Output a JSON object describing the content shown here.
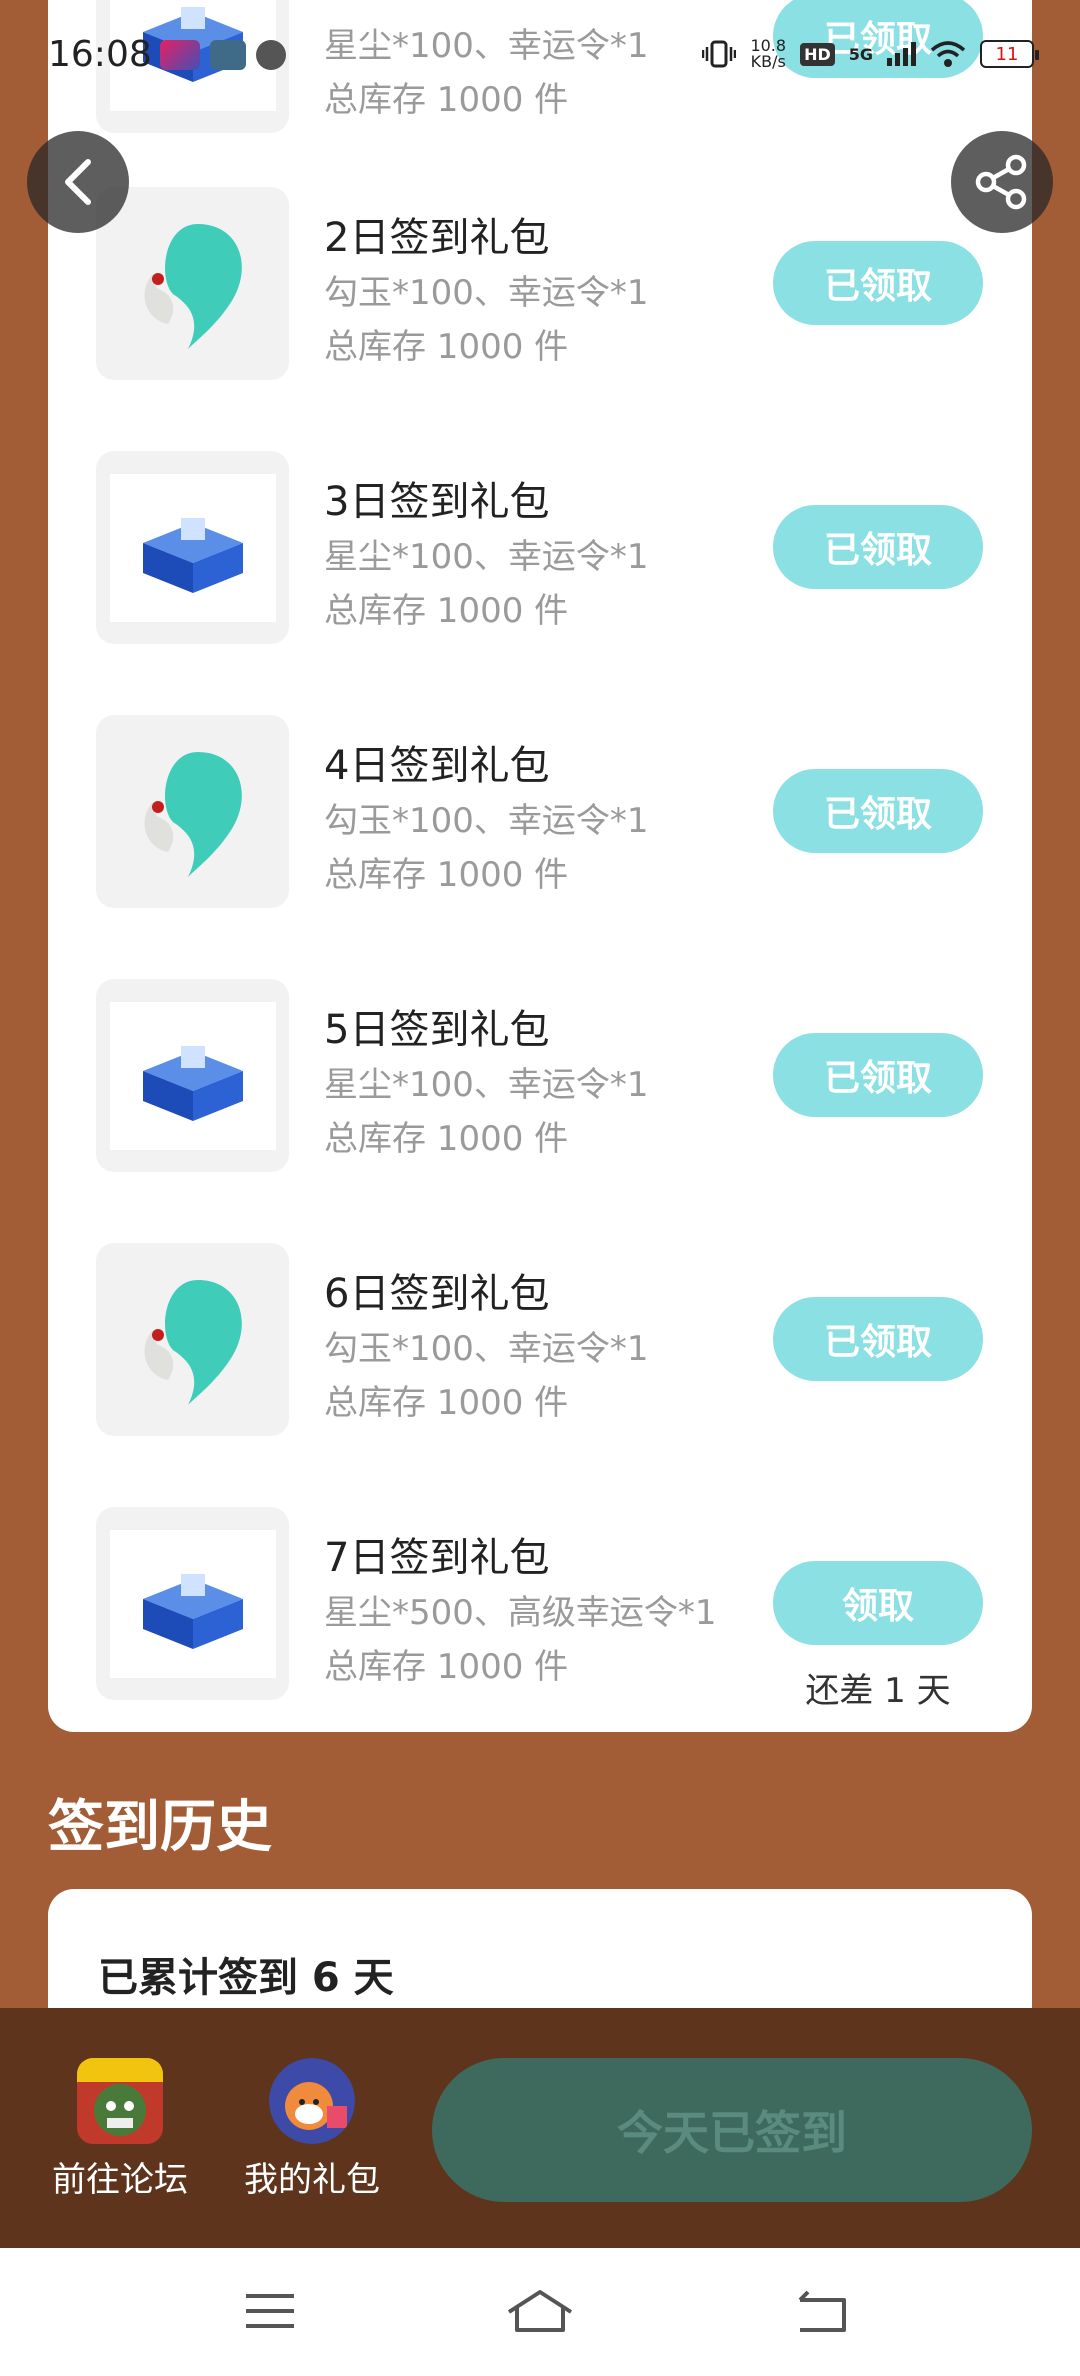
{
  "status_bar": {
    "time": "16:08",
    "net_speed": "10.8",
    "net_unit": "KB/s",
    "hd": "HD",
    "network": "5G",
    "battery": "11"
  },
  "gifts": [
    {
      "title": "",
      "desc": "星尘*100、幸运令*1",
      "stock": "总库存 1000 件",
      "icon": "blue-chest-icon",
      "button": "已领取",
      "remain": ""
    },
    {
      "title": "2日签到礼包",
      "desc": "勾玉*100、幸运令*1",
      "stock": "总库存 1000 件",
      "icon": "jade-magatama-icon",
      "button": "已领取",
      "remain": ""
    },
    {
      "title": "3日签到礼包",
      "desc": "星尘*100、幸运令*1",
      "stock": "总库存 1000 件",
      "icon": "blue-chest-icon",
      "button": "已领取",
      "remain": ""
    },
    {
      "title": "4日签到礼包",
      "desc": "勾玉*100、幸运令*1",
      "stock": "总库存 1000 件",
      "icon": "jade-magatama-icon",
      "button": "已领取",
      "remain": ""
    },
    {
      "title": "5日签到礼包",
      "desc": "星尘*100、幸运令*1",
      "stock": "总库存 1000 件",
      "icon": "blue-chest-icon",
      "button": "已领取",
      "remain": ""
    },
    {
      "title": "6日签到礼包",
      "desc": "勾玉*100、幸运令*1",
      "stock": "总库存 1000 件",
      "icon": "jade-magatama-icon",
      "button": "已领取",
      "remain": ""
    },
    {
      "title": "7日签到礼包",
      "desc": "星尘*500、高级幸运令*1",
      "stock": "总库存 1000 件",
      "icon": "blue-chest-icon",
      "button": "领取",
      "remain": "还差 1 天"
    }
  ],
  "history": {
    "heading": "签到历史",
    "count": "已累计签到 6 天"
  },
  "bottom_bar": {
    "forum_label": "前往论坛",
    "gifts_label": "我的礼包",
    "signin_label": "今天已签到"
  },
  "colors": {
    "page_bg": "#a35d36",
    "bottom_bar_bg": "#5e341c",
    "claim_button": "#8ae0e3",
    "signin_button": "#3e6a5e"
  }
}
